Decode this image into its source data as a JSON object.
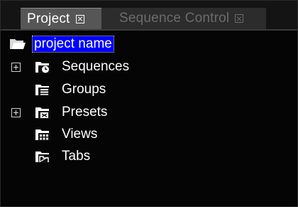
{
  "tabs": [
    {
      "label": "Project",
      "active": true
    },
    {
      "label": "Sequence Control",
      "active": false
    }
  ],
  "tree": {
    "root": {
      "label": "project name",
      "icon": "folder-open-icon",
      "selected": true
    },
    "items": [
      {
        "label": "Sequences",
        "icon": "sequences-folder-icon",
        "expandable": true
      },
      {
        "label": "Groups",
        "icon": "groups-folder-icon",
        "expandable": false
      },
      {
        "label": "Presets",
        "icon": "presets-folder-icon",
        "expandable": true
      },
      {
        "label": "Views",
        "icon": "views-folder-icon",
        "expandable": false
      },
      {
        "label": "Tabs",
        "icon": "tabs-folder-icon",
        "expandable": false
      }
    ]
  },
  "colors": {
    "selection": "#0000ff",
    "background": "#050505",
    "active_tab": "#565656",
    "inactive_tab": "#2c2c2c"
  }
}
